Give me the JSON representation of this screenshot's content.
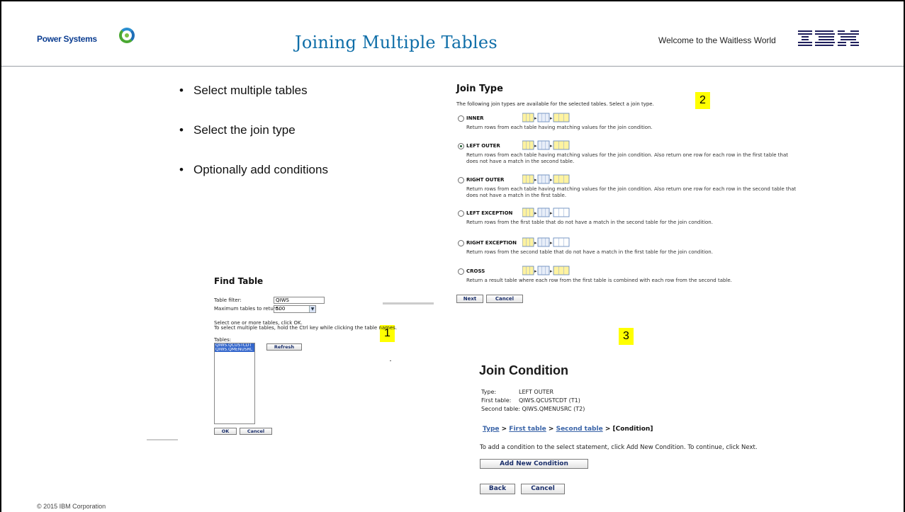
{
  "header": {
    "brand": "Power Systems",
    "title": "Joining Multiple Tables",
    "tagline": "Welcome to the Waitless World",
    "ibm_logo_text": "IBM"
  },
  "bullets": [
    "Select multiple tables",
    "Select the join type",
    "Optionally add conditions"
  ],
  "callouts": [
    "1",
    "2",
    "3"
  ],
  "join_type": {
    "title": "Join Type",
    "intro": "The following join types are available for the selected tables. Select a join type.",
    "options": [
      {
        "label": "INNER",
        "desc": "Return rows from each table having matching values for the join condition.",
        "selected": false
      },
      {
        "label": "LEFT OUTER",
        "desc": "Return rows from each table having matching values for the join condition. Also return one row for each row in the first table that does not have a match in the second table.",
        "selected": true
      },
      {
        "label": "RIGHT OUTER",
        "desc": "Return rows from each table having matching values for the join condition. Also return one row for each row in the second table that does not have a match in the first table.",
        "selected": false
      },
      {
        "label": "LEFT EXCEPTION",
        "desc": "Return rows from the first table that do not have a match in the second table for the join condition.",
        "selected": false
      },
      {
        "label": "RIGHT EXCEPTION",
        "desc": "Return rows from the second table that do not have a match in the first table for the join condition.",
        "selected": false
      },
      {
        "label": "CROSS",
        "desc": "Return a result table where each row from the first table is combined with each row from the second table.",
        "selected": false
      }
    ],
    "next_label": "Next",
    "cancel_label": "Cancel"
  },
  "find_table": {
    "title": "Find Table",
    "filter_label": "Table filter:",
    "filter_value": "QIWS",
    "max_label": "Maximum tables to return:",
    "max_value": "500",
    "instruction_1": "Select one or more tables, click OK.",
    "instruction_2": "To select multiple tables, hold the Ctrl key while clicking the table names.",
    "tables_label": "Tables:",
    "tables": [
      "QIWS.QCUSTCDT",
      "QIWS.QMENUSRC"
    ],
    "refresh_label": "Refresh",
    "ok_label": "OK",
    "cancel_label": "Cancel"
  },
  "join_condition": {
    "title": "Join Condition",
    "type_key": "Type:",
    "type_value": "LEFT OUTER",
    "first_key": "First table:",
    "first_value": "QIWS.QCUSTCDT (T1)",
    "second_key": "Second table:",
    "second_value": "QIWS.QMENUSRC (T2)",
    "crumb_type": "Type",
    "crumb_first": "First table",
    "crumb_second": "Second table",
    "crumb_current": "[Condition]",
    "help": "To add a condition to the select statement, click Add New Condition. To continue, click Next.",
    "add_label": "Add New Condition",
    "back_label": "Back",
    "cancel_label": "Cancel"
  },
  "footer": {
    "copyright": "© 2015 IBM Corporation"
  }
}
